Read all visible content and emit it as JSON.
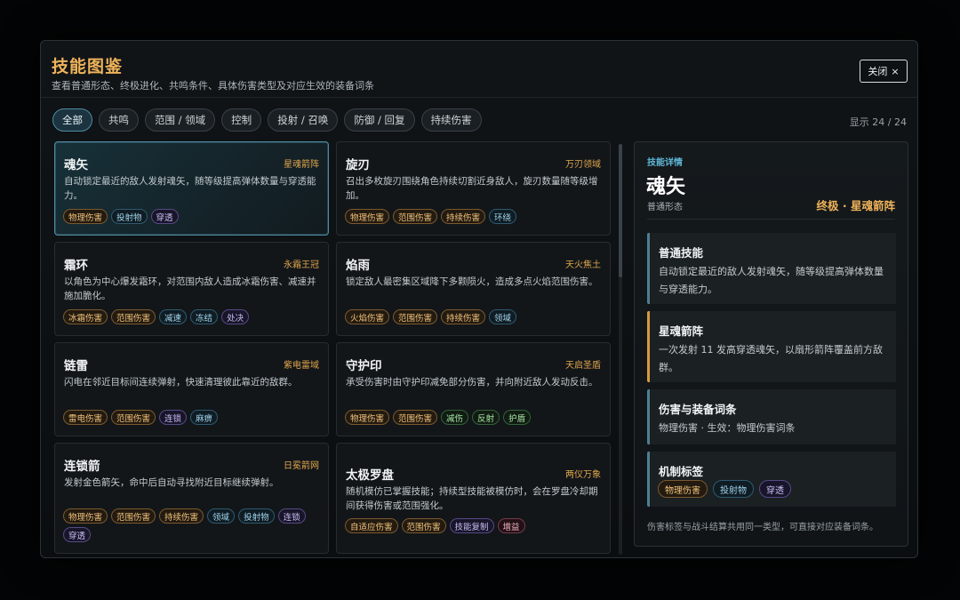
{
  "header": {
    "title": "技能图鉴",
    "subtitle": "查看普通形态、终极进化、共鸣条件、具体伤害类型及对应生效的装备词条",
    "close_label": "关闭",
    "close_icon": "×"
  },
  "filters": {
    "items": [
      "全部",
      "共鸣",
      "范围 / 领域",
      "控制",
      "投射 / 召唤",
      "防御 / 回复",
      "持续伤害"
    ],
    "active_index": 0,
    "count_text": "显示 24 / 24"
  },
  "cards": [
    {
      "name": "魂矢",
      "set": "星魂箭阵",
      "desc": "自动锁定最近的敌人发射魂矢，随等级提高弹体数量与穿透能力。",
      "tags": [
        {
          "label": "物理伤害",
          "color": "orange"
        },
        {
          "label": "投射物",
          "color": "blue"
        },
        {
          "label": "穿透",
          "color": "purple"
        }
      ]
    },
    {
      "name": "旋刃",
      "set": "万刃领域",
      "desc": "召出多枚旋刃围绕角色持续切割近身敌人，旋刃数量随等级增加。",
      "tags": [
        {
          "label": "物理伤害",
          "color": "orange"
        },
        {
          "label": "范围伤害",
          "color": "orange"
        },
        {
          "label": "持续伤害",
          "color": "orange"
        },
        {
          "label": "环绕",
          "color": "blue"
        }
      ]
    },
    {
      "name": "霜环",
      "set": "永霜王冠",
      "desc": "以角色为中心爆发霜环，对范围内敌人造成冰霜伤害、减速并施加脆化。",
      "tags": [
        {
          "label": "冰霜伤害",
          "color": "orange"
        },
        {
          "label": "范围伤害",
          "color": "orange"
        },
        {
          "label": "减速",
          "color": "blue"
        },
        {
          "label": "冻结",
          "color": "blue"
        },
        {
          "label": "处决",
          "color": "purple"
        }
      ]
    },
    {
      "name": "焰雨",
      "set": "天火焦土",
      "desc": "锁定敌人最密集区域降下多颗陨火，造成多点火焰范围伤害。",
      "tags": [
        {
          "label": "火焰伤害",
          "color": "orange"
        },
        {
          "label": "范围伤害",
          "color": "orange"
        },
        {
          "label": "持续伤害",
          "color": "orange"
        },
        {
          "label": "领域",
          "color": "blue"
        }
      ]
    },
    {
      "name": "链雷",
      "set": "紫电雷域",
      "desc": "闪电在邻近目标间连续弹射，快速清理彼此靠近的敌群。",
      "tags": [
        {
          "label": "雷电伤害",
          "color": "orange"
        },
        {
          "label": "范围伤害",
          "color": "orange"
        },
        {
          "label": "连锁",
          "color": "purple"
        },
        {
          "label": "麻痹",
          "color": "blue"
        }
      ]
    },
    {
      "name": "守护印",
      "set": "天启圣盾",
      "desc": "承受伤害时由守护印减免部分伤害，并向附近敌人发动反击。",
      "tags": [
        {
          "label": "物理伤害",
          "color": "orange"
        },
        {
          "label": "范围伤害",
          "color": "orange"
        },
        {
          "label": "减伤",
          "color": "green"
        },
        {
          "label": "反射",
          "color": "green"
        },
        {
          "label": "护盾",
          "color": "green"
        }
      ]
    },
    {
      "name": "连锁箭",
      "set": "日冕箭网",
      "desc": "发射金色箭矢，命中后自动寻找附近目标继续弹射。",
      "tags": [
        {
          "label": "物理伤害",
          "color": "orange"
        },
        {
          "label": "范围伤害",
          "color": "orange"
        },
        {
          "label": "持续伤害",
          "color": "orange"
        },
        {
          "label": "领域",
          "color": "blue"
        },
        {
          "label": "投射物",
          "color": "blue"
        },
        {
          "label": "连锁",
          "color": "purple"
        },
        {
          "label": "穿透",
          "color": "purple"
        }
      ]
    },
    {
      "name": "太极罗盘",
      "set": "两仪万象",
      "desc": "随机模仿已掌握技能；持续型技能被模仿时，会在罗盘冷却期间获得伤害或范围强化。",
      "tags": [
        {
          "label": "自适应伤害",
          "color": "orange"
        },
        {
          "label": "范围伤害",
          "color": "orange"
        },
        {
          "label": "技能复制",
          "color": "purple"
        },
        {
          "label": "增益",
          "color": "pink"
        }
      ]
    }
  ],
  "detail": {
    "header": "技能详情",
    "name": "魂矢",
    "form": "普通形态",
    "tier": "终极 · 星魂箭阵",
    "normal_title": "普通技能",
    "normal_body": "自动锁定最近的敌人发射魂矢，随等级提高弹体数量与穿透能力。",
    "ultimate_title": "星魂箭阵",
    "ultimate_body": "一次发射 11 发高穿透魂矢，以扇形箭阵覆盖前方敌群。",
    "damage_title": "伤害与装备词条",
    "damage_body": "物理伤害 · 生效：物理伤害词条",
    "tags_title": "机制标签",
    "tags": [
      {
        "label": "物理伤害",
        "color": "orange"
      },
      {
        "label": "投射物",
        "color": "blue"
      },
      {
        "label": "穿透",
        "color": "purple"
      }
    ],
    "footer": "伤害标签与战斗结算共用同一类型，可直接对应装备词条。"
  }
}
